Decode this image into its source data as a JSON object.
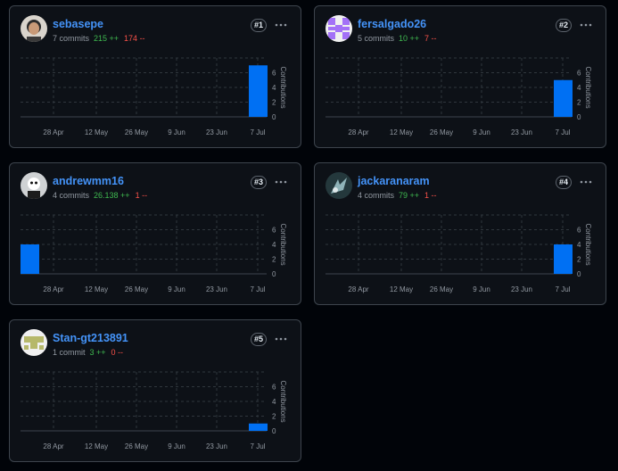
{
  "colors": {
    "accent": "#4493f8",
    "bar": "#0070f3",
    "additions": "#3fb950",
    "deletions": "#f85149"
  },
  "icons": {
    "menu": "kebab-horizontal-icon"
  },
  "chart_data": [
    {
      "type": "bar",
      "categories": [
        "28 Apr",
        "12 May",
        "26 May",
        "9 Jun",
        "23 Jun",
        "7 Jul"
      ],
      "x_range": [
        "2025-04-21",
        "2025-07-13"
      ],
      "bars": [
        {
          "week": "7 Jul",
          "value": 7
        }
      ],
      "ylabel": "Contributions",
      "yticks": [
        0,
        2,
        4,
        6
      ],
      "ylim": [
        0,
        8
      ],
      "grid": true
    },
    {
      "type": "bar",
      "categories": [
        "28 Apr",
        "12 May",
        "26 May",
        "9 Jun",
        "23 Jun",
        "7 Jul"
      ],
      "x_range": [
        "2025-04-21",
        "2025-07-13"
      ],
      "bars": [
        {
          "week": "7 Jul",
          "value": 5
        }
      ],
      "ylabel": "Contributions",
      "yticks": [
        0,
        2,
        4,
        6
      ],
      "ylim": [
        0,
        8
      ],
      "grid": true
    },
    {
      "type": "bar",
      "categories": [
        "28 Apr",
        "12 May",
        "26 May",
        "9 Jun",
        "23 Jun",
        "7 Jul"
      ],
      "x_range": [
        "2025-04-21",
        "2025-07-13"
      ],
      "bars": [
        {
          "week": "21 Apr",
          "value": 4
        }
      ],
      "ylabel": "Contributions",
      "yticks": [
        0,
        2,
        4,
        6
      ],
      "ylim": [
        0,
        8
      ],
      "grid": true
    },
    {
      "type": "bar",
      "categories": [
        "28 Apr",
        "12 May",
        "26 May",
        "9 Jun",
        "23 Jun",
        "7 Jul"
      ],
      "x_range": [
        "2025-04-21",
        "2025-07-13"
      ],
      "bars": [
        {
          "week": "7 Jul",
          "value": 4
        }
      ],
      "ylabel": "Contributions",
      "yticks": [
        0,
        2,
        4,
        6
      ],
      "ylim": [
        0,
        8
      ],
      "grid": true
    },
    {
      "type": "bar",
      "categories": [
        "28 Apr",
        "12 May",
        "26 May",
        "9 Jun",
        "23 Jun",
        "7 Jul"
      ],
      "x_range": [
        "2025-04-21",
        "2025-07-13"
      ],
      "bars": [
        {
          "week": "7 Jul",
          "value": 1
        }
      ],
      "ylabel": "Contributions",
      "yticks": [
        0,
        2,
        4,
        6
      ],
      "ylim": [
        0,
        8
      ],
      "grid": true
    }
  ],
  "contributors": [
    {
      "username": "sebasepe",
      "commits": "7 commits",
      "additions": "215 ++",
      "deletions": "174 --",
      "rank": "#1",
      "avatar": "photo-avatar"
    },
    {
      "username": "fersalgado26",
      "commits": "5 commits",
      "additions": "10 ++",
      "deletions": "7 --",
      "rank": "#2",
      "avatar": "purple-identicon",
      "avatar_color": "#a371f7"
    },
    {
      "username": "andrewmm16",
      "commits": "4 commits",
      "additions": "26.138 ++",
      "deletions": "1 --",
      "rank": "#3",
      "avatar": "photo-avatar"
    },
    {
      "username": "jackaranaram",
      "commits": "4 commits",
      "additions": "79 ++",
      "deletions": "1 --",
      "rank": "#4",
      "avatar": "photo-avatar"
    },
    {
      "username": "Stan-gt213891",
      "commits": "1 commit",
      "additions": "3 ++",
      "deletions": "0 --",
      "rank": "#5",
      "avatar": "olive-identicon",
      "avatar_color": "#b6b86a"
    }
  ]
}
